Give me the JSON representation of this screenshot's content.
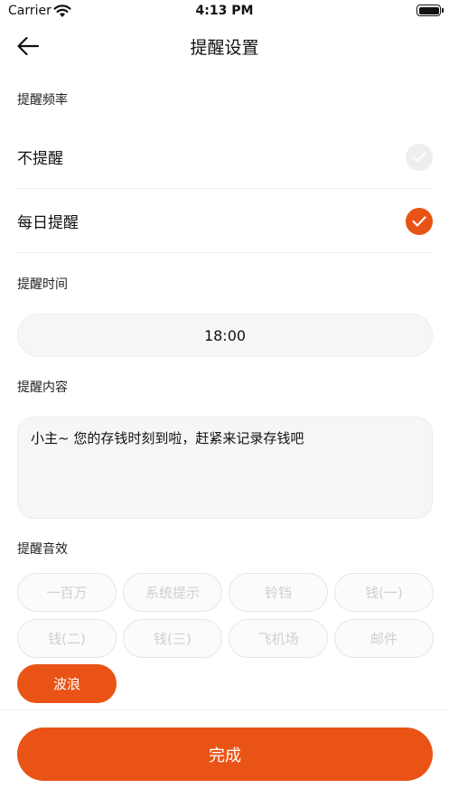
{
  "status_bar": {
    "carrier": "Carrier",
    "time": "4:13 PM"
  },
  "nav": {
    "title": "提醒设置"
  },
  "frequency": {
    "label": "提醒频率",
    "options": [
      {
        "label": "不提醒",
        "selected": false
      },
      {
        "label": "每日提醒",
        "selected": true
      }
    ]
  },
  "time_section": {
    "label": "提醒时间",
    "value": "18:00"
  },
  "content_section": {
    "label": "提醒内容",
    "text": "小主~ 您的存钱时刻到啦，赶紧来记录存钱吧"
  },
  "sound_section": {
    "label": "提醒音效",
    "options": [
      {
        "label": "一百万",
        "selected": false
      },
      {
        "label": "系统提示",
        "selected": false
      },
      {
        "label": "铃铛",
        "selected": false
      },
      {
        "label": "钱(一)",
        "selected": false
      },
      {
        "label": "钱(二)",
        "selected": false
      },
      {
        "label": "钱(三)",
        "selected": false
      },
      {
        "label": "飞机场",
        "selected": false
      },
      {
        "label": "邮件",
        "selected": false
      },
      {
        "label": "波浪",
        "selected": true
      }
    ]
  },
  "footer": {
    "done_label": "完成"
  },
  "colors": {
    "accent": "#e95416",
    "chip_border": "#e6e6e6",
    "field_bg": "#f6f6f6"
  }
}
